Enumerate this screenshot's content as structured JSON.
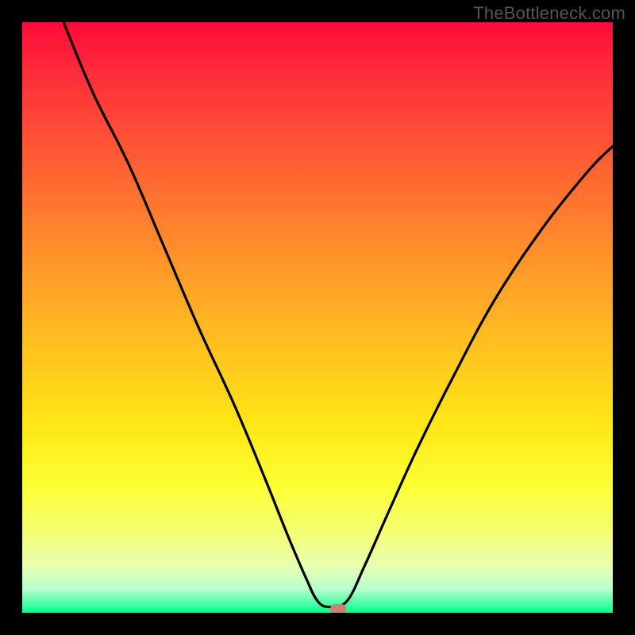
{
  "watermark": "TheBottleneck.com",
  "marker": {
    "x_pct": 53.5,
    "y_pct": 99.3
  },
  "chart_data": {
    "type": "line",
    "title": "",
    "xlabel": "",
    "ylabel": "",
    "xlim_pct": [
      0,
      100
    ],
    "ylim_pct": [
      0,
      100
    ],
    "series": [
      {
        "name": "bottleneck-curve",
        "x_pct": [
          7,
          12,
          18,
          24,
          30,
          36,
          41,
          45,
          48,
          50,
          52,
          55,
          58,
          62,
          67,
          73,
          80,
          88,
          96,
          100
        ],
        "y_pct": [
          0,
          12,
          24,
          38,
          52,
          65,
          77,
          87,
          94,
          98,
          99,
          98,
          92,
          83,
          72,
          60,
          47,
          35,
          25,
          21
        ]
      }
    ],
    "background_gradient": {
      "top": "#ff0a3a",
      "mid": "#ffe617",
      "bottom": "#00ff8c"
    }
  }
}
